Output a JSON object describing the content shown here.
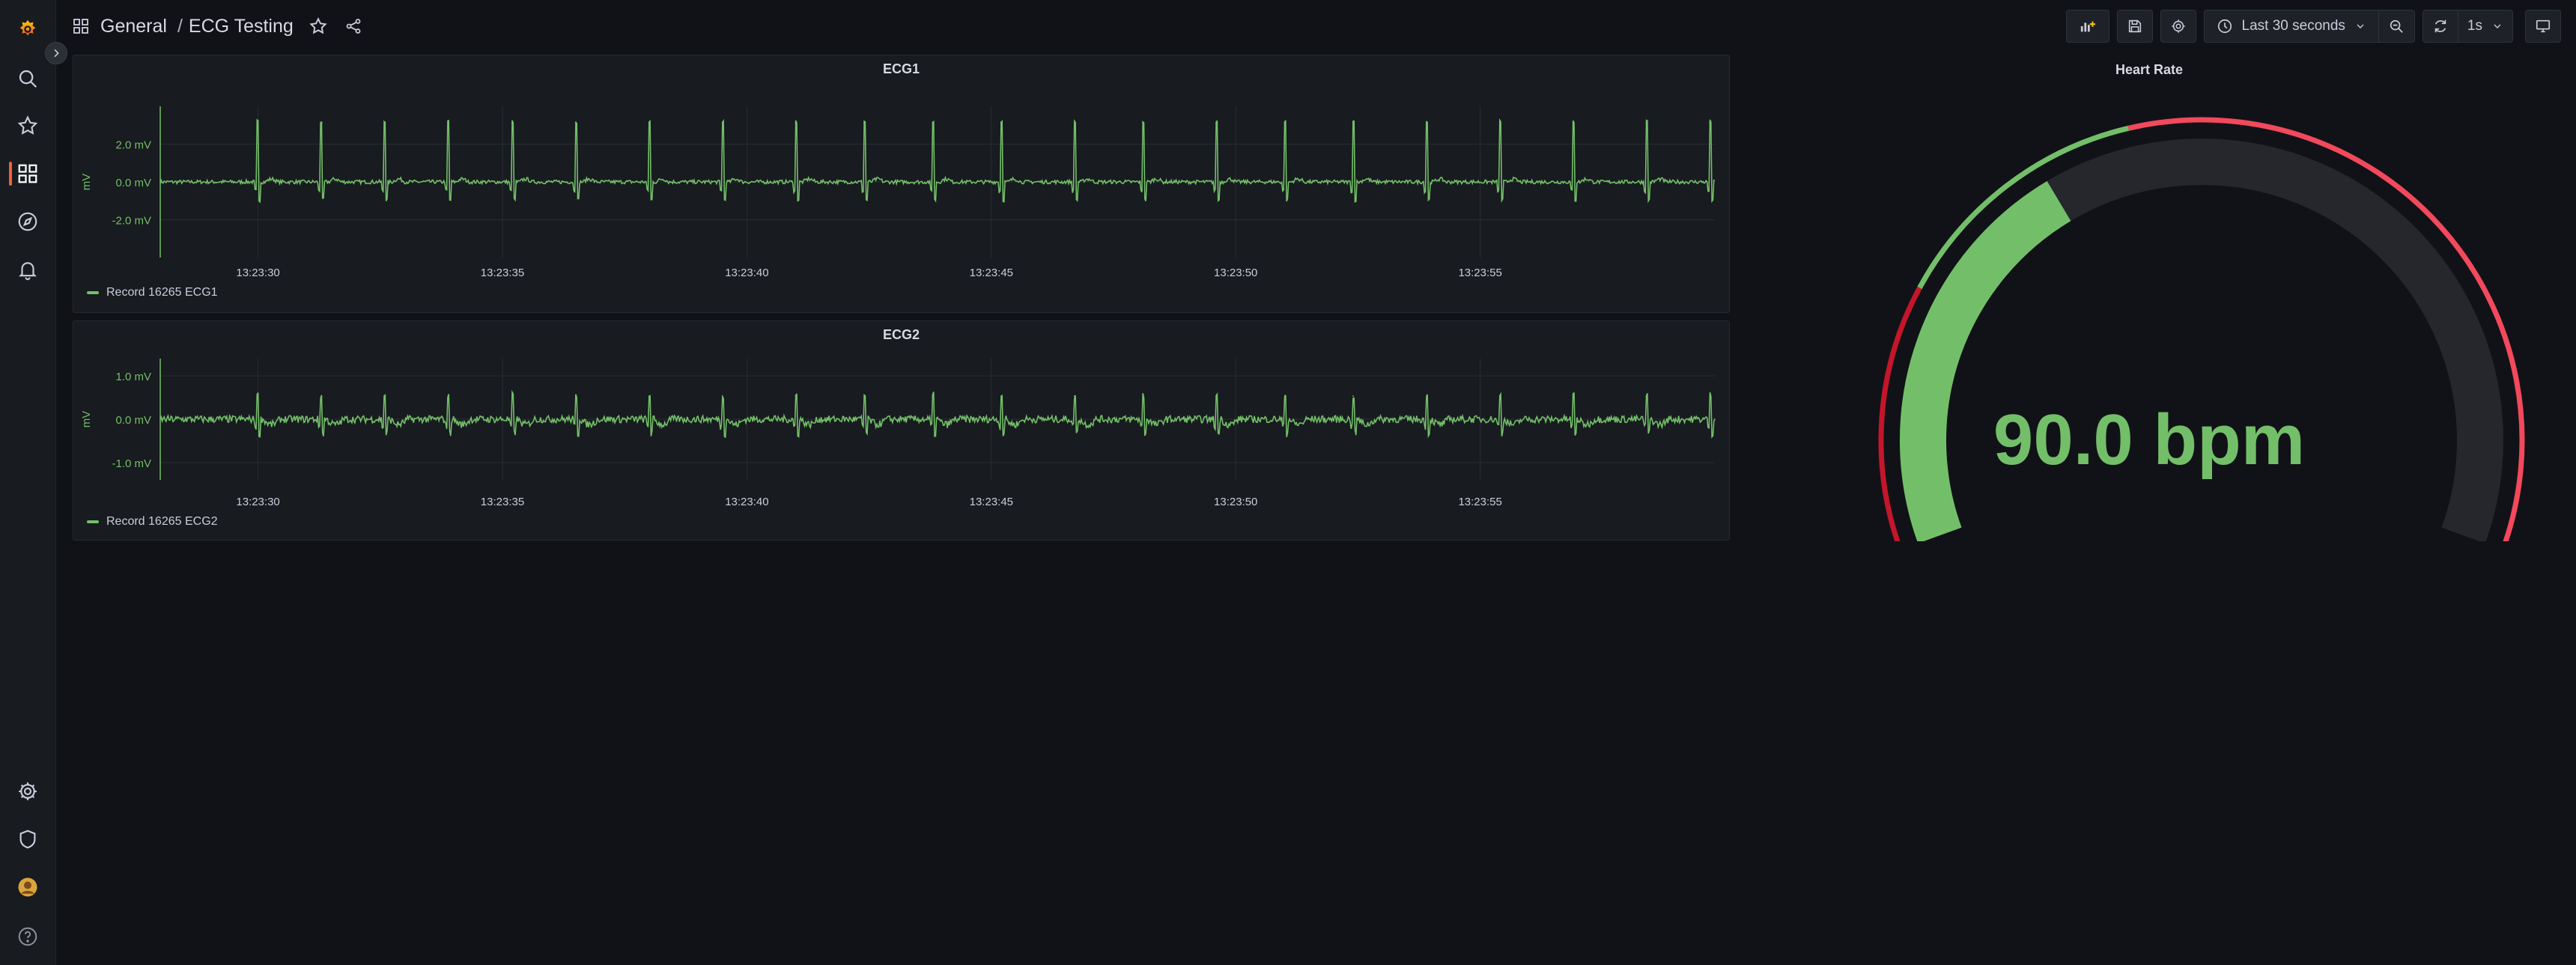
{
  "breadcrumb": {
    "folder": "General",
    "separator": "/",
    "dashboard": "ECG Testing"
  },
  "toolbar": {
    "time_range": "Last 30 seconds",
    "refresh_interval": "1s"
  },
  "sidebar": {
    "items": [
      {
        "name": "grafana-logo-icon"
      },
      {
        "name": "search-icon"
      },
      {
        "name": "star-icon"
      },
      {
        "name": "dashboards-icon",
        "active": true
      },
      {
        "name": "explore-icon"
      },
      {
        "name": "bell-icon"
      },
      {
        "name": "gear-icon"
      },
      {
        "name": "shield-icon"
      },
      {
        "name": "avatar"
      },
      {
        "name": "help-icon"
      }
    ]
  },
  "panels": {
    "ecg1": {
      "title": "ECG1",
      "legend": "Record 16265 ECG1"
    },
    "ecg2": {
      "title": "ECG2",
      "legend": "Record 16265 ECG2"
    },
    "heart_rate": {
      "title": "Heart Rate",
      "value": "90.0 bpm"
    }
  },
  "colors": {
    "series": "#73bf69",
    "threshold_red": "#f2495c",
    "dark_red": "#c4162a",
    "accent": "#f55f3e"
  },
  "chart_data": [
    {
      "type": "line",
      "title": "ECG1",
      "ylabel": "mV",
      "ylim": [
        -4,
        4
      ],
      "yticks": [
        "2.0 mV",
        "0.0 mV",
        "-2.0 mV"
      ],
      "xticks": [
        "13:23:30",
        "13:23:35",
        "13:23:40",
        "13:23:45",
        "13:23:50",
        "13:23:55"
      ],
      "series": [
        {
          "name": "Record 16265 ECG1",
          "r_peak_times_s": [
            0.0,
            1.3,
            2.6,
            3.9,
            5.2,
            6.5,
            8.0,
            9.5,
            11.0,
            12.4,
            13.8,
            15.2,
            16.7,
            18.1,
            19.6,
            21.0,
            22.4,
            23.9,
            25.4,
            26.9,
            28.4,
            29.7
          ],
          "r_peak_mv": 3.2,
          "baseline_mv": 0.0
        }
      ],
      "grid": true
    },
    {
      "type": "line",
      "title": "ECG2",
      "ylabel": "mV",
      "ylim": [
        -1.4,
        1.4
      ],
      "yticks": [
        "1.0 mV",
        "0.0 mV",
        "-1.0 mV"
      ],
      "xticks": [
        "13:23:30",
        "13:23:35",
        "13:23:40",
        "13:23:45",
        "13:23:50",
        "13:23:55"
      ],
      "series": [
        {
          "name": "Record 16265 ECG2",
          "r_peak_times_s": [
            0.0,
            1.3,
            2.6,
            3.9,
            5.2,
            6.5,
            8.0,
            9.5,
            11.0,
            12.4,
            13.8,
            15.2,
            16.7,
            18.1,
            19.6,
            21.0,
            22.4,
            23.9,
            25.4,
            26.9,
            28.4,
            29.7
          ],
          "r_peak_mv": 0.55,
          "baseline_mv": 0.0
        }
      ],
      "grid": true
    },
    {
      "type": "gauge",
      "title": "Heart Rate",
      "value": 90.0,
      "unit": "bpm",
      "min": 0,
      "max": 250,
      "thresholds": [
        {
          "color": "#c4162a",
          "from": 0,
          "to": 55
        },
        {
          "color": "#73bf69",
          "from": 55,
          "to": 110
        },
        {
          "color": "#f2495c",
          "from": 110,
          "to": 250
        }
      ]
    }
  ]
}
